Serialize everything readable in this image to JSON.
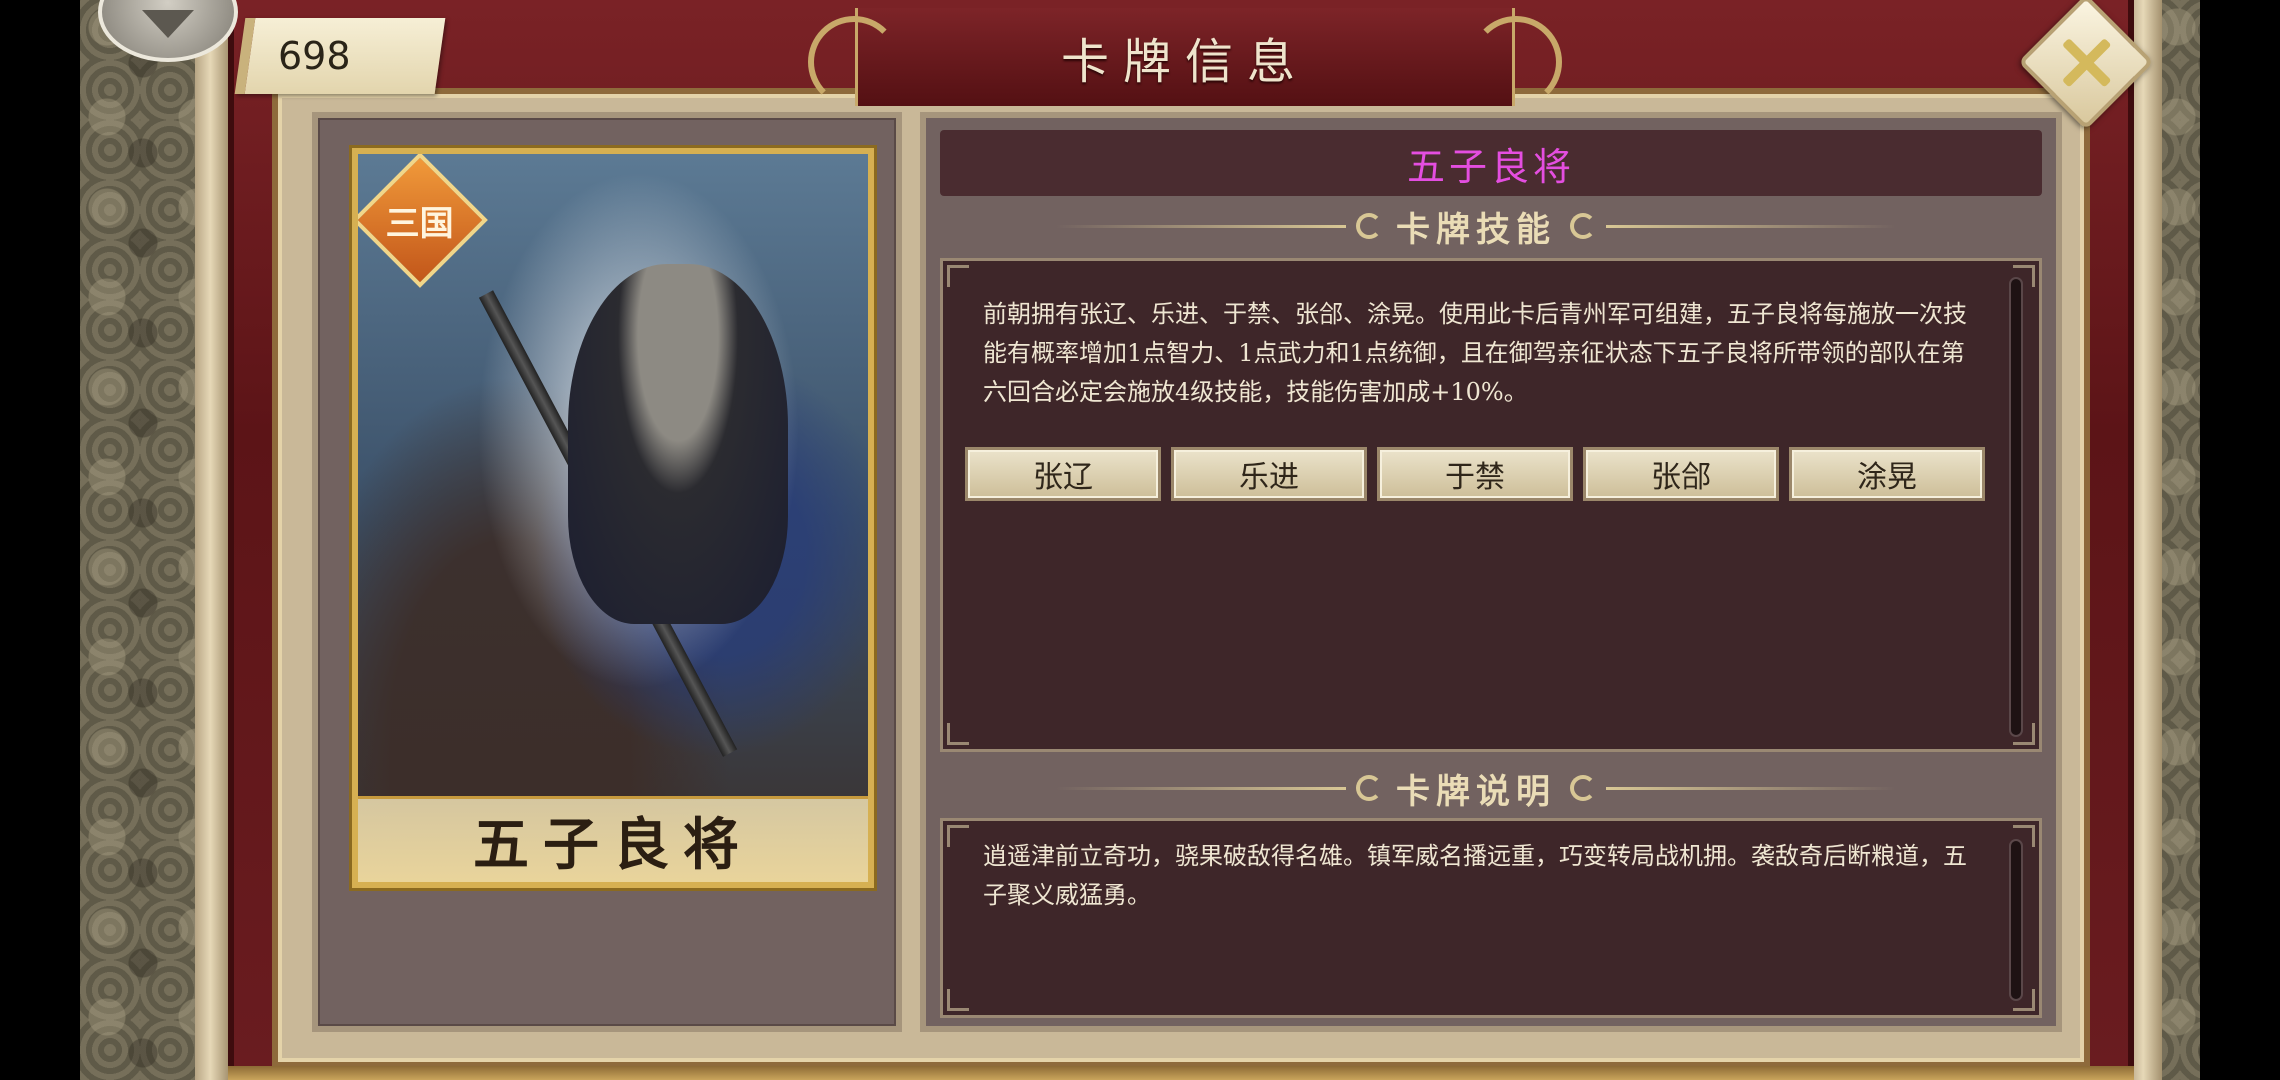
{
  "window": {
    "title": "卡牌信息",
    "counter": "698"
  },
  "card": {
    "badge": "三国",
    "name": "五子良将"
  },
  "info": {
    "card_title": "五子良将",
    "card_title_color": "#e44ee0",
    "skill_section_title": "卡牌技能",
    "skill_text": "前朝拥有张辽、乐进、于禁、张郃、涂晃。使用此卡后青州军可组建，五子良将每施放一次技能有概率增加1点智力、1点武力和1点统御，且在御驾亲征状态下五子良将所带领的部队在第六回合必定会施放4级技能，技能伤害加成+10%。",
    "generals": [
      "张辽",
      "乐进",
      "于禁",
      "张郃",
      "涂晃"
    ],
    "description_section_title": "卡牌说明",
    "description_text": "逍遥津前立奇功，骁果破敌得名雄。镇军威名播远重，巧变转局战机拥。袭敌奇后断粮道，五子聚义威猛勇。"
  }
}
